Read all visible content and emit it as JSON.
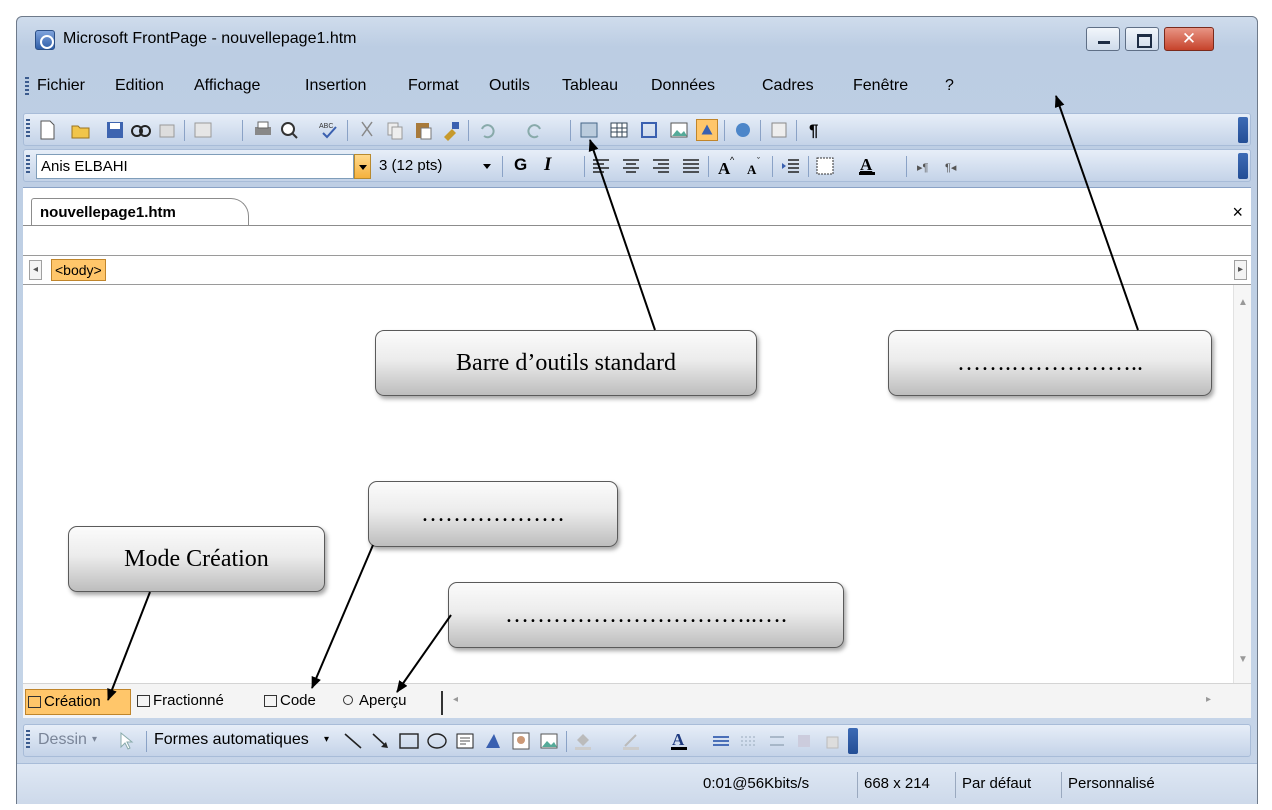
{
  "window": {
    "title": "Microsoft FrontPage - nouvellepage1.htm",
    "close_glyph": "✕"
  },
  "menubar": {
    "items": [
      "Fichier",
      "Edition",
      "Affichage",
      "Insertion",
      "Format",
      "Outils",
      "Tableau",
      "Données",
      "Cadres",
      "Fenêtre",
      "?"
    ]
  },
  "formatting_toolbar": {
    "font_name": "Anis ELBAHI",
    "font_size": "3  (12 pts)",
    "bold": "G",
    "italic": "I"
  },
  "document": {
    "tab_label": "nouvellepage1.htm",
    "tab_close": "×",
    "tag_selector": "<body>"
  },
  "view_modes": {
    "creation": "Création",
    "split": "Fractionné",
    "code": "Code",
    "preview": "Aperçu"
  },
  "drawing_toolbar": {
    "draw_label": "Dessin",
    "autoshapes_label": "Formes automatiques"
  },
  "statusbar": {
    "speed": "0:01@56Kbits/s",
    "dimensions": "668 x 214",
    "style": "Par défaut",
    "mode": "Personnalisé"
  },
  "annotations": {
    "standard_toolbar": "Barre d’outils standard",
    "menu_blank": "…….……………..",
    "mode_creation": "Mode Création",
    "code_blank": "………………",
    "preview_blank": "…………………………..…."
  },
  "colors": {
    "accent_orange": "#ffc66a",
    "chrome_blue": "#c4d3e8",
    "close_red": "#c6432b"
  }
}
